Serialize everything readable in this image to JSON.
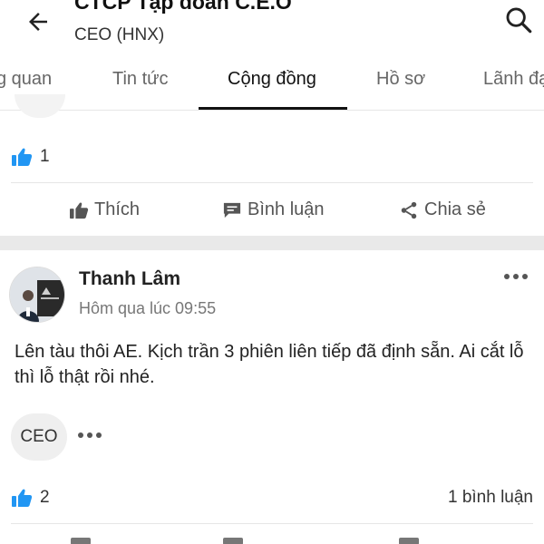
{
  "header": {
    "title": "CTCP Tập đoàn C.E.O",
    "subtitle": "CEO (HNX)",
    "back_icon": "arrow-left-icon",
    "search_icon": "search-icon"
  },
  "tabs": [
    {
      "label": "g quan",
      "active": false
    },
    {
      "label": "Tin tức",
      "active": false
    },
    {
      "label": "Cộng đồng",
      "active": true
    },
    {
      "label": "Hồ sơ",
      "active": false
    },
    {
      "label": "Lãnh đạ",
      "active": false
    }
  ],
  "post_prev": {
    "like_count": "1",
    "actions": {
      "like": "Thích",
      "comment": "Bình luận",
      "share": "Chia sẻ"
    }
  },
  "post": {
    "author": "Thanh Lâm",
    "time": "Hôm qua lúc 09:55",
    "text": "Lên tàu thôi AE. Kịch trần 3 phiên liên tiếp đã định sẵn. Ai cắt lỗ thì lỗ thật rồi nhé.",
    "tag": "CEO",
    "like_count": "2",
    "comment_count": "1 bình luận"
  },
  "colors": {
    "like_blue": "#2196f3",
    "tab_active": "#111111",
    "divider": "#e6e6e6",
    "section_gap": "#e9e9e9"
  }
}
